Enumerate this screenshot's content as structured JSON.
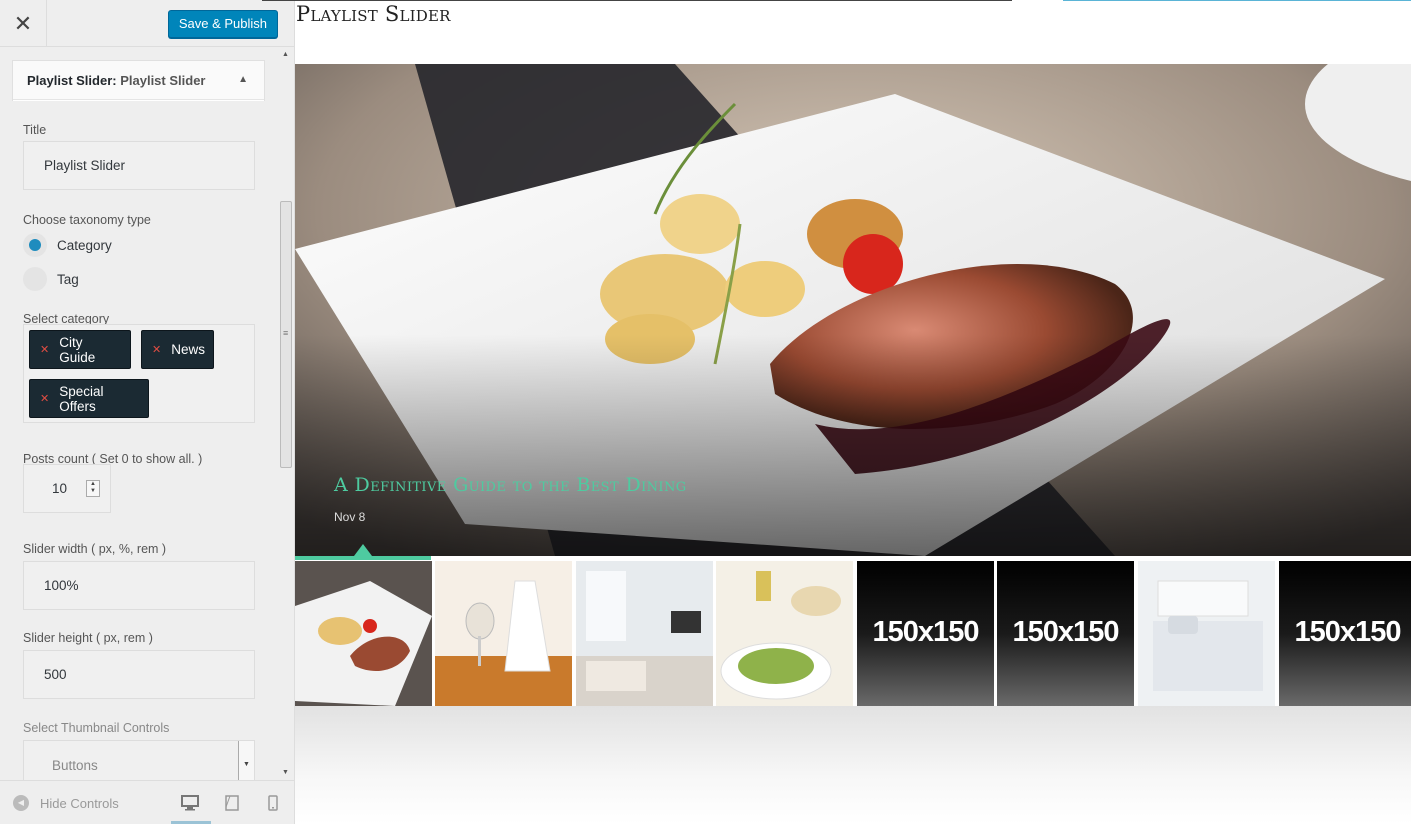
{
  "topbar": {
    "close_symbol": "✕",
    "publish_label": "Save & Publish"
  },
  "widget": {
    "heading": "Playlist Slider:",
    "heading_sub": "Playlist Slider",
    "title_label": "Title",
    "title_value": "Playlist Slider",
    "taxonomy_label": "Choose taxonomy type",
    "taxonomy_options": [
      {
        "label": "Category",
        "checked": true
      },
      {
        "label": "Tag",
        "checked": false
      }
    ],
    "category_label": "Select category",
    "categories": [
      "City Guide",
      "News",
      "Special Offers"
    ],
    "posts_count_label": "Posts count ( Set 0 to show all. )",
    "posts_count_value": "10",
    "slider_width_label": "Slider width ( px, %, rem )",
    "slider_width_value": "100%",
    "slider_height_label": "Slider height ( px, rem )",
    "slider_height_value": "500",
    "thumb_controls_label": "Select Thumbnail Controls",
    "thumb_controls_value": "Buttons"
  },
  "footer": {
    "hide_controls_label": "Hide Controls"
  },
  "preview": {
    "page_title": "Playlist Slider",
    "slide_title": "A Definitive Guide to the Best Dining",
    "slide_date": "Nov 8",
    "thumbnails": [
      {
        "kind": "photo",
        "subject": "duck dish"
      },
      {
        "kind": "photo",
        "subject": "restaurant table setting"
      },
      {
        "kind": "photo",
        "subject": "living room"
      },
      {
        "kind": "photo",
        "subject": "pasta dish"
      },
      {
        "kind": "placeholder",
        "text": "150x150"
      },
      {
        "kind": "placeholder",
        "text": "150x150"
      },
      {
        "kind": "photo",
        "subject": "bedroom"
      },
      {
        "kind": "placeholder",
        "text": "150x150"
      }
    ]
  },
  "colors": {
    "accent": "#4ecba0",
    "publish_blue": "#0085ba",
    "radio_blue": "#1e8cbe",
    "chip_dark": "#1b2a33"
  },
  "icons": [
    "close-icon",
    "collapse-arrow-icon",
    "remove-chip-icon",
    "hide-controls-icon",
    "desktop-icon",
    "tablet-icon",
    "mobile-icon"
  ]
}
